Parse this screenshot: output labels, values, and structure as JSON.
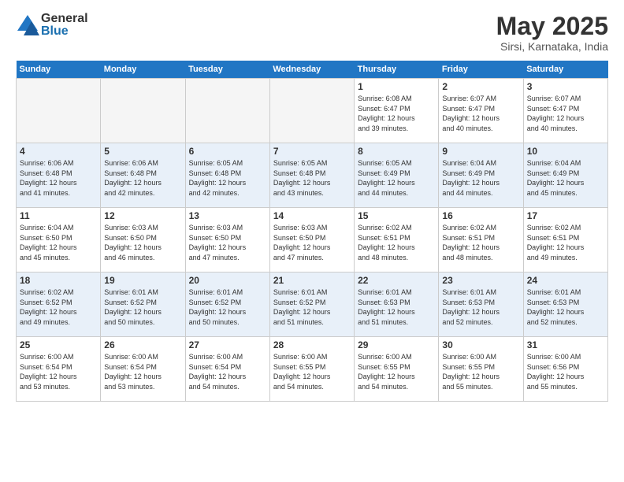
{
  "header": {
    "logo_general": "General",
    "logo_blue": "Blue",
    "month_title": "May 2025",
    "location": "Sirsi, Karnataka, India"
  },
  "weekdays": [
    "Sunday",
    "Monday",
    "Tuesday",
    "Wednesday",
    "Thursday",
    "Friday",
    "Saturday"
  ],
  "weeks": [
    [
      {
        "day": "",
        "info": ""
      },
      {
        "day": "",
        "info": ""
      },
      {
        "day": "",
        "info": ""
      },
      {
        "day": "",
        "info": ""
      },
      {
        "day": "1",
        "info": "Sunrise: 6:08 AM\nSunset: 6:47 PM\nDaylight: 12 hours\nand 39 minutes."
      },
      {
        "day": "2",
        "info": "Sunrise: 6:07 AM\nSunset: 6:47 PM\nDaylight: 12 hours\nand 40 minutes."
      },
      {
        "day": "3",
        "info": "Sunrise: 6:07 AM\nSunset: 6:47 PM\nDaylight: 12 hours\nand 40 minutes."
      }
    ],
    [
      {
        "day": "4",
        "info": "Sunrise: 6:06 AM\nSunset: 6:48 PM\nDaylight: 12 hours\nand 41 minutes."
      },
      {
        "day": "5",
        "info": "Sunrise: 6:06 AM\nSunset: 6:48 PM\nDaylight: 12 hours\nand 42 minutes."
      },
      {
        "day": "6",
        "info": "Sunrise: 6:05 AM\nSunset: 6:48 PM\nDaylight: 12 hours\nand 42 minutes."
      },
      {
        "day": "7",
        "info": "Sunrise: 6:05 AM\nSunset: 6:48 PM\nDaylight: 12 hours\nand 43 minutes."
      },
      {
        "day": "8",
        "info": "Sunrise: 6:05 AM\nSunset: 6:49 PM\nDaylight: 12 hours\nand 44 minutes."
      },
      {
        "day": "9",
        "info": "Sunrise: 6:04 AM\nSunset: 6:49 PM\nDaylight: 12 hours\nand 44 minutes."
      },
      {
        "day": "10",
        "info": "Sunrise: 6:04 AM\nSunset: 6:49 PM\nDaylight: 12 hours\nand 45 minutes."
      }
    ],
    [
      {
        "day": "11",
        "info": "Sunrise: 6:04 AM\nSunset: 6:50 PM\nDaylight: 12 hours\nand 45 minutes."
      },
      {
        "day": "12",
        "info": "Sunrise: 6:03 AM\nSunset: 6:50 PM\nDaylight: 12 hours\nand 46 minutes."
      },
      {
        "day": "13",
        "info": "Sunrise: 6:03 AM\nSunset: 6:50 PM\nDaylight: 12 hours\nand 47 minutes."
      },
      {
        "day": "14",
        "info": "Sunrise: 6:03 AM\nSunset: 6:50 PM\nDaylight: 12 hours\nand 47 minutes."
      },
      {
        "day": "15",
        "info": "Sunrise: 6:02 AM\nSunset: 6:51 PM\nDaylight: 12 hours\nand 48 minutes."
      },
      {
        "day": "16",
        "info": "Sunrise: 6:02 AM\nSunset: 6:51 PM\nDaylight: 12 hours\nand 48 minutes."
      },
      {
        "day": "17",
        "info": "Sunrise: 6:02 AM\nSunset: 6:51 PM\nDaylight: 12 hours\nand 49 minutes."
      }
    ],
    [
      {
        "day": "18",
        "info": "Sunrise: 6:02 AM\nSunset: 6:52 PM\nDaylight: 12 hours\nand 49 minutes."
      },
      {
        "day": "19",
        "info": "Sunrise: 6:01 AM\nSunset: 6:52 PM\nDaylight: 12 hours\nand 50 minutes."
      },
      {
        "day": "20",
        "info": "Sunrise: 6:01 AM\nSunset: 6:52 PM\nDaylight: 12 hours\nand 50 minutes."
      },
      {
        "day": "21",
        "info": "Sunrise: 6:01 AM\nSunset: 6:52 PM\nDaylight: 12 hours\nand 51 minutes."
      },
      {
        "day": "22",
        "info": "Sunrise: 6:01 AM\nSunset: 6:53 PM\nDaylight: 12 hours\nand 51 minutes."
      },
      {
        "day": "23",
        "info": "Sunrise: 6:01 AM\nSunset: 6:53 PM\nDaylight: 12 hours\nand 52 minutes."
      },
      {
        "day": "24",
        "info": "Sunrise: 6:01 AM\nSunset: 6:53 PM\nDaylight: 12 hours\nand 52 minutes."
      }
    ],
    [
      {
        "day": "25",
        "info": "Sunrise: 6:00 AM\nSunset: 6:54 PM\nDaylight: 12 hours\nand 53 minutes."
      },
      {
        "day": "26",
        "info": "Sunrise: 6:00 AM\nSunset: 6:54 PM\nDaylight: 12 hours\nand 53 minutes."
      },
      {
        "day": "27",
        "info": "Sunrise: 6:00 AM\nSunset: 6:54 PM\nDaylight: 12 hours\nand 54 minutes."
      },
      {
        "day": "28",
        "info": "Sunrise: 6:00 AM\nSunset: 6:55 PM\nDaylight: 12 hours\nand 54 minutes."
      },
      {
        "day": "29",
        "info": "Sunrise: 6:00 AM\nSunset: 6:55 PM\nDaylight: 12 hours\nand 54 minutes."
      },
      {
        "day": "30",
        "info": "Sunrise: 6:00 AM\nSunset: 6:55 PM\nDaylight: 12 hours\nand 55 minutes."
      },
      {
        "day": "31",
        "info": "Sunrise: 6:00 AM\nSunset: 6:56 PM\nDaylight: 12 hours\nand 55 minutes."
      }
    ]
  ]
}
